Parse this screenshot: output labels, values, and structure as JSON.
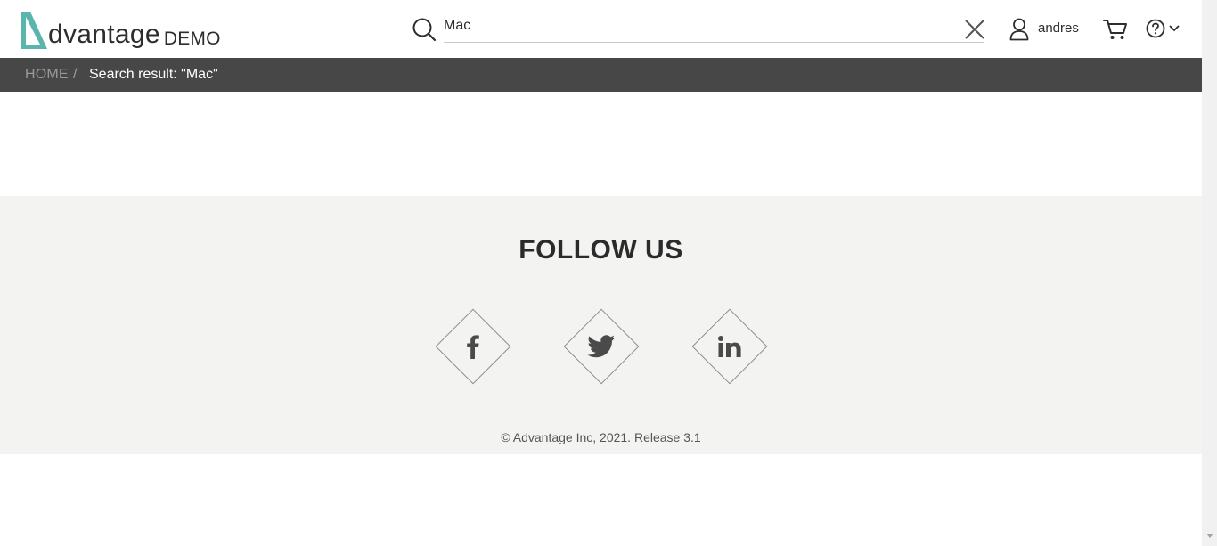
{
  "header": {
    "logo": {
      "main": "dvantage",
      "sub": "DEMO"
    },
    "search": {
      "value": "Mac",
      "placeholder": ""
    },
    "user": {
      "name": "andres"
    },
    "icons": [
      "search-icon",
      "close-icon",
      "user-icon",
      "cart-icon",
      "help-icon",
      "chevron-down-icon"
    ]
  },
  "breadcrumb": {
    "home": "HOME",
    "separator": "/",
    "current": "Search result: \"Mac\""
  },
  "footer": {
    "follow_title": "FOLLOW US",
    "social": [
      {
        "name": "facebook",
        "icon": "facebook-icon"
      },
      {
        "name": "twitter",
        "icon": "twitter-icon"
      },
      {
        "name": "linkedin",
        "icon": "linkedin-icon"
      }
    ],
    "copyright": "© Advantage Inc, 2021. Release 3.1"
  },
  "colors": {
    "brand_teal": "#5ab5ad",
    "breadcrumb_bg": "#474747",
    "footer_bg": "#f3f3f1"
  }
}
